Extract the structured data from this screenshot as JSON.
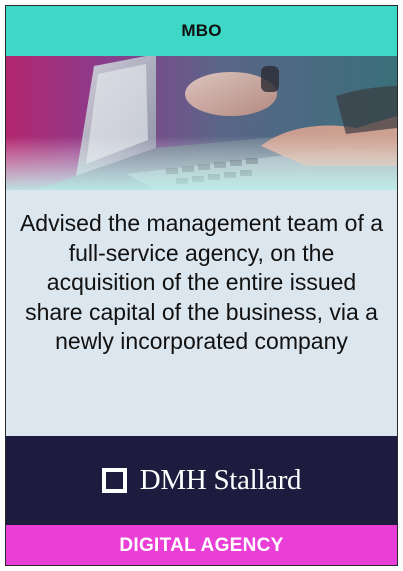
{
  "header": {
    "title": "MBO"
  },
  "image": {
    "subject": "laptop-keyboard-photo"
  },
  "description": "Advised the management team of a full-service agency, on the acquisition of the entire issued share capital of the business, via a newly incorporated company",
  "brand": {
    "name": "DMH Stallard",
    "logo_icon": "square-outline-logo"
  },
  "footer": {
    "sector": "DIGITAL AGENCY"
  },
  "colors": {
    "header": "#3dd8c6",
    "body": "#dbe6ee",
    "brand": "#1d1c3e",
    "footer": "#ea3fd7"
  }
}
